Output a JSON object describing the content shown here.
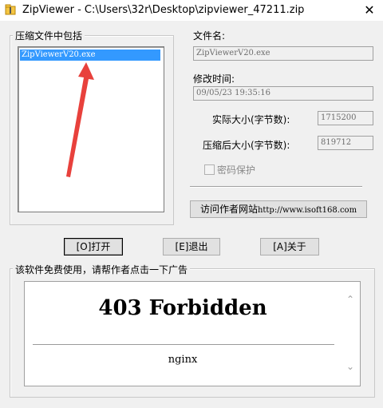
{
  "window": {
    "title": "ZipViewer - C:\\Users\\32r\\Desktop\\zipviewer_47211.zip",
    "close_glyph": "✕"
  },
  "archive_group": {
    "label": "压缩文件中包括",
    "items": [
      "ZipViewerV20.exe"
    ]
  },
  "details": {
    "filename_label": "文件名:",
    "filename_value": "ZipViewerV20.exe",
    "modified_label": "修改时间:",
    "modified_value": "09/05/23 19:35:16",
    "actual_size_label": "实际大小(字节数):",
    "actual_size_value": "1715200",
    "compressed_size_label": "压缩后大小(字节数):",
    "compressed_size_value": "819712",
    "password_label": "密码保护",
    "website_button_prefix": "访问作者网站",
    "website_button_url": "http://www.isoft168.com"
  },
  "actions": {
    "open_label": "[O]打开",
    "exit_label": "[E]退出",
    "about_label": "[A]关于"
  },
  "ad_group": {
    "label": "该软件免费使用，请帮作者点击一下广告",
    "heading": "403 Forbidden",
    "footer": "nginx"
  },
  "colors": {
    "selection": "#3399ff",
    "arrow": "#e8413c"
  },
  "icons": {
    "app": "zip-folder-icon",
    "close": "close-icon",
    "annotation": "red-arrow"
  }
}
